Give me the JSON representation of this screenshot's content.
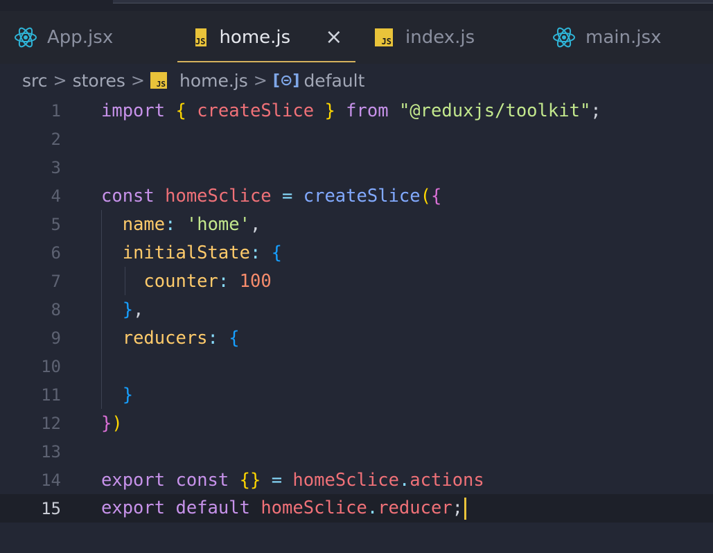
{
  "tabs": [
    {
      "label": "App.jsx",
      "icon": "react-icon"
    },
    {
      "label": "home.js",
      "icon": "js-icon",
      "active": true
    },
    {
      "label": "index.js",
      "icon": "js-icon"
    },
    {
      "label": "main.jsx",
      "icon": "react-icon"
    }
  ],
  "close_glyph": "×",
  "js_badge_text": "JS",
  "breadcrumb": {
    "segments": [
      "src",
      "stores",
      "home.js",
      "default"
    ],
    "separator": ">"
  },
  "colors": {
    "keyword": "#c792ea",
    "variable": "#f07178",
    "function": "#82aaff",
    "property": "#ffcb6b",
    "string": "#c3e88d",
    "number": "#f78c6c",
    "punctuation": "#89ddff",
    "bracket_gold": "#ffd700",
    "bracket_pink": "#da70d6",
    "bracket_blue": "#179fff",
    "plain": "#cfd3dc"
  },
  "editor": {
    "current_line": 15,
    "lines": [
      {
        "n": "1",
        "tokens": [
          [
            "import",
            "keyword"
          ],
          [
            " ",
            "plain"
          ],
          [
            "{",
            "bracket_gold"
          ],
          [
            " ",
            "plain"
          ],
          [
            "createSlice",
            "variable"
          ],
          [
            " ",
            "plain"
          ],
          [
            "}",
            "bracket_gold"
          ],
          [
            " ",
            "plain"
          ],
          [
            "from",
            "keyword"
          ],
          [
            " ",
            "plain"
          ],
          [
            "\"@reduxjs/toolkit\"",
            "string"
          ],
          [
            ";",
            "plain"
          ]
        ]
      },
      {
        "n": "2",
        "tokens": []
      },
      {
        "n": "3",
        "tokens": []
      },
      {
        "n": "4",
        "tokens": [
          [
            "const",
            "keyword"
          ],
          [
            " ",
            "plain"
          ],
          [
            "homeSclice",
            "variable"
          ],
          [
            " ",
            "plain"
          ],
          [
            "=",
            "punctuation"
          ],
          [
            " ",
            "plain"
          ],
          [
            "createSlice",
            "function"
          ],
          [
            "(",
            "bracket_gold"
          ],
          [
            "{",
            "bracket_pink"
          ]
        ]
      },
      {
        "n": "5",
        "guide": 1,
        "tokens": [
          [
            "  ",
            "plain"
          ],
          [
            "name",
            "property"
          ],
          [
            ":",
            "punctuation"
          ],
          [
            " ",
            "plain"
          ],
          [
            "'home'",
            "string"
          ],
          [
            ",",
            "plain"
          ]
        ]
      },
      {
        "n": "6",
        "guide": 1,
        "tokens": [
          [
            "  ",
            "plain"
          ],
          [
            "initialState",
            "property"
          ],
          [
            ":",
            "punctuation"
          ],
          [
            " ",
            "plain"
          ],
          [
            "{",
            "bracket_blue"
          ]
        ]
      },
      {
        "n": "7",
        "guide": 2,
        "tokens": [
          [
            "    ",
            "plain"
          ],
          [
            "counter",
            "property"
          ],
          [
            ":",
            "punctuation"
          ],
          [
            " ",
            "plain"
          ],
          [
            "100",
            "number"
          ]
        ]
      },
      {
        "n": "8",
        "guide": 1,
        "tokens": [
          [
            "  ",
            "plain"
          ],
          [
            "}",
            "bracket_blue"
          ],
          [
            ",",
            "plain"
          ]
        ]
      },
      {
        "n": "9",
        "guide": 1,
        "tokens": [
          [
            "  ",
            "plain"
          ],
          [
            "reducers",
            "property"
          ],
          [
            ":",
            "punctuation"
          ],
          [
            " ",
            "plain"
          ],
          [
            "{",
            "bracket_blue"
          ]
        ]
      },
      {
        "n": "10",
        "guide": 1,
        "tokens": []
      },
      {
        "n": "11",
        "guide": 1,
        "tokens": [
          [
            "  ",
            "plain"
          ],
          [
            "}",
            "bracket_blue"
          ]
        ]
      },
      {
        "n": "12",
        "tokens": [
          [
            "}",
            "bracket_pink"
          ],
          [
            ")",
            "bracket_gold"
          ]
        ]
      },
      {
        "n": "13",
        "tokens": []
      },
      {
        "n": "14",
        "tokens": [
          [
            "export",
            "keyword"
          ],
          [
            " ",
            "plain"
          ],
          [
            "const",
            "keyword"
          ],
          [
            " ",
            "plain"
          ],
          [
            "{}",
            "bracket_gold"
          ],
          [
            " ",
            "plain"
          ],
          [
            "=",
            "punctuation"
          ],
          [
            " ",
            "plain"
          ],
          [
            "homeSclice",
            "variable"
          ],
          [
            ".",
            "punctuation"
          ],
          [
            "actions",
            "variable"
          ]
        ]
      },
      {
        "n": "15",
        "tokens": [
          [
            "export",
            "keyword"
          ],
          [
            " ",
            "plain"
          ],
          [
            "default",
            "keyword"
          ],
          [
            " ",
            "plain"
          ],
          [
            "homeSclice",
            "variable"
          ],
          [
            ".",
            "punctuation"
          ],
          [
            "reducer",
            "variable"
          ],
          [
            ";",
            "plain"
          ]
        ]
      }
    ]
  }
}
